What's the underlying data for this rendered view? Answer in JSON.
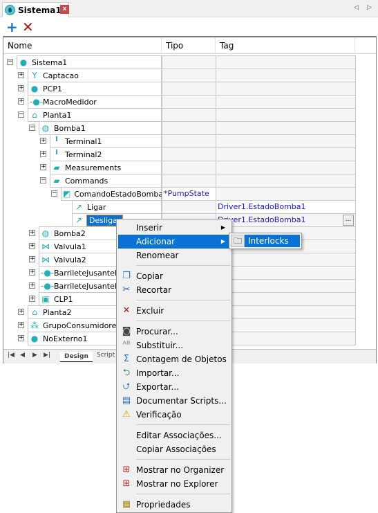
{
  "tab": {
    "title": "Sistema1",
    "close": "x",
    "icon": "water-drop-icon"
  },
  "toolbar": {
    "add": "+",
    "delete": "✕"
  },
  "columns": [
    "Nome",
    "Tipo",
    "Tag"
  ],
  "rows": [
    {
      "level": 0,
      "exp": "−",
      "icon": "water-drop-icon",
      "glyph": "●",
      "name": "Sistema1",
      "tipo": "",
      "tag": ""
    },
    {
      "level": 1,
      "exp": "+",
      "icon": "intake-icon",
      "glyph": "Y",
      "name": "Captacao",
      "tipo": "",
      "tag": ""
    },
    {
      "level": 1,
      "exp": "+",
      "icon": "well-icon",
      "glyph": "●",
      "name": "PCP1",
      "tipo": "",
      "tag": ""
    },
    {
      "level": 1,
      "exp": "+",
      "icon": "meter-icon",
      "glyph": "-●-",
      "name": "MacroMedidor",
      "tipo": "",
      "tag": ""
    },
    {
      "level": 1,
      "exp": "−",
      "icon": "plant-icon",
      "glyph": "⌂",
      "name": "Planta1",
      "tipo": "",
      "tag": ""
    },
    {
      "level": 2,
      "exp": "−",
      "icon": "pump-icon",
      "glyph": "◍",
      "name": "Bomba1",
      "tipo": "",
      "tag": ""
    },
    {
      "level": 3,
      "exp": "+",
      "icon": "terminal-icon",
      "glyph": "╹",
      "name": "Terminal1",
      "tipo": "",
      "tag": ""
    },
    {
      "level": 3,
      "exp": "+",
      "icon": "terminal-icon",
      "glyph": "╹",
      "name": "Terminal2",
      "tipo": "",
      "tag": ""
    },
    {
      "level": 3,
      "exp": "+",
      "icon": "folder-icon",
      "glyph": "▰",
      "name": "Measurements",
      "tipo": "",
      "tag": ""
    },
    {
      "level": 3,
      "exp": "−",
      "icon": "folder-icon",
      "glyph": "▰",
      "name": "Commands",
      "tipo": "",
      "tag": ""
    },
    {
      "level": 4,
      "exp": "−",
      "icon": "command-icon",
      "glyph": "◩",
      "name": "ComandoEstadoBomba",
      "tipo": "*PumpState",
      "tag": ""
    },
    {
      "level": 5,
      "exp": "",
      "icon": "command-on-icon",
      "glyph": "↗",
      "name": "Ligar",
      "tipo": "",
      "tag": "Driver1.EstadoBomba1"
    },
    {
      "level": 5,
      "exp": "",
      "icon": "command-off-icon",
      "glyph": "↗",
      "name": "Desligar",
      "tipo": "",
      "tag": "Driver1.EstadoBomba1",
      "selected": true
    },
    {
      "level": 2,
      "exp": "+",
      "icon": "pump-icon",
      "glyph": "◍",
      "name": "Bomba2",
      "tipo": "",
      "tag": ""
    },
    {
      "level": 2,
      "exp": "+",
      "icon": "valve-icon",
      "glyph": "⋈",
      "name": "Valvula1",
      "tipo": "",
      "tag": ""
    },
    {
      "level": 2,
      "exp": "+",
      "icon": "valve-icon",
      "glyph": "⋈",
      "name": "Valvula2",
      "tipo": "",
      "tag": ""
    },
    {
      "level": 2,
      "exp": "+",
      "icon": "pipe-icon",
      "glyph": "-●-",
      "name": "BarrileteJusanteB1",
      "tipo": "",
      "tag": ""
    },
    {
      "level": 2,
      "exp": "+",
      "icon": "pipe-icon",
      "glyph": "-●-",
      "name": "BarrileteJusanteB2",
      "tipo": "",
      "tag": ""
    },
    {
      "level": 2,
      "exp": "+",
      "icon": "plc-icon",
      "glyph": "▣",
      "name": "CLP1",
      "tipo": "",
      "tag": ""
    },
    {
      "level": 1,
      "exp": "+",
      "icon": "plant-icon",
      "glyph": "⌂",
      "name": "Planta2",
      "tipo": "",
      "tag": ""
    },
    {
      "level": 1,
      "exp": "+",
      "icon": "consumers-icon",
      "glyph": "⁂",
      "name": "GrupoConsumidores2",
      "tipo": "",
      "tag": ""
    },
    {
      "level": 1,
      "exp": "+",
      "icon": "external-node-icon",
      "glyph": "●",
      "name": "NoExterno1",
      "tipo": "",
      "tag": ""
    }
  ],
  "ellipsis": "...",
  "bottom_tabs": {
    "design": "Design",
    "script": "Script"
  },
  "menu": [
    {
      "label": "Inserir",
      "submenu": true,
      "icon": ""
    },
    {
      "label": "Adicionar",
      "submenu": true,
      "highlight": true,
      "icon": ""
    },
    {
      "label": "Renomear",
      "icon": ""
    },
    {
      "sep": true
    },
    {
      "label": "Copiar",
      "icon": "copy-icon",
      "glyph": "❐",
      "color": "#2a6fc0"
    },
    {
      "label": "Recortar",
      "icon": "cut-icon",
      "glyph": "✂",
      "color": "#3060a0"
    },
    {
      "sep": true
    },
    {
      "label": "Excluir",
      "icon": "delete-icon",
      "glyph": "✕",
      "color": "#b01818"
    },
    {
      "sep": true
    },
    {
      "label": "Procurar...",
      "icon": "binoculars-icon",
      "glyph": "◙",
      "color": "#444"
    },
    {
      "label": "Substituir...",
      "icon": "replace-icon",
      "glyph": "ᴬᴮ",
      "color": "#888"
    },
    {
      "label": "Contagem de Objetos",
      "icon": "sigma-icon",
      "glyph": "Σ",
      "color": "#2a6fc0"
    },
    {
      "label": "Importar...",
      "icon": "import-icon",
      "glyph": "⮌",
      "color": "#2a8a3a"
    },
    {
      "label": "Exportar...",
      "icon": "export-icon",
      "glyph": "⮍",
      "color": "#2a6fc0"
    },
    {
      "label": "Documentar Scripts...",
      "icon": "book-icon",
      "glyph": "▤",
      "color": "#2a6fc0"
    },
    {
      "label": "Verificação",
      "icon": "warning-icon",
      "glyph": "⚠",
      "color": "#d6a300"
    },
    {
      "sep": true
    },
    {
      "label": "Editar Associações...",
      "icon": ""
    },
    {
      "label": "Copiar Associações",
      "icon": ""
    },
    {
      "sep": true
    },
    {
      "label": "Mostrar no Organizer",
      "icon": "organizer-icon",
      "glyph": "⊞",
      "color": "#c03030"
    },
    {
      "label": "Mostrar no Explorer",
      "icon": "explorer-icon",
      "glyph": "⊞",
      "color": "#c03030"
    },
    {
      "sep": true
    },
    {
      "label": "Propriedades",
      "icon": "properties-icon",
      "glyph": "▦",
      "color": "#b08a20"
    }
  ],
  "submenu": {
    "label": "Interlocks",
    "icon": "locked-folder-icon"
  }
}
